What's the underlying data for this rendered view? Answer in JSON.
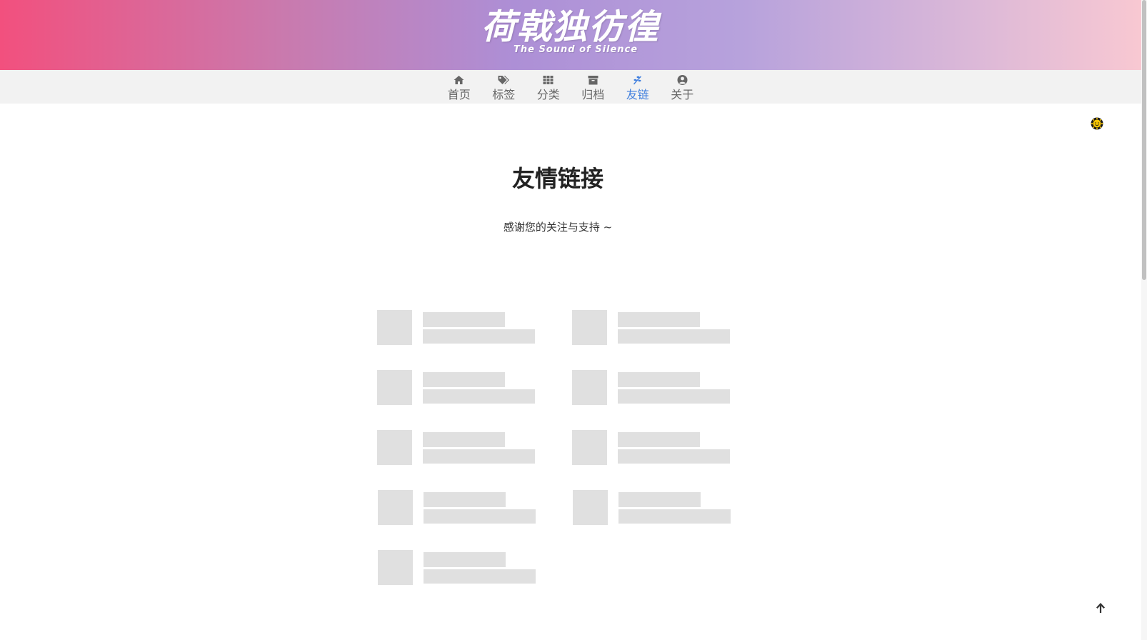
{
  "site": {
    "title_cn": "荷戟独彷徨",
    "title_en": "The Sound of Silence"
  },
  "nav": {
    "items": [
      {
        "label": "首页",
        "icon": "home-icon"
      },
      {
        "label": "标签",
        "icon": "tags-icon"
      },
      {
        "label": "分类",
        "icon": "grid-icon"
      },
      {
        "label": "归档",
        "icon": "archive-icon"
      },
      {
        "label": "友链",
        "icon": "leaf-icon",
        "active": true
      },
      {
        "label": "关于",
        "icon": "user-circle-icon"
      }
    ],
    "active_color": "#3f7ede"
  },
  "theme_toggle": {
    "icon": "sun-icon"
  },
  "main": {
    "title": "友情链接",
    "subtitle": "感谢您的关注与支持 ~"
  },
  "friend_links": {
    "state": "loading",
    "placeholder_count": 9
  },
  "back_to_top": {
    "icon": "arrow-up-icon"
  }
}
